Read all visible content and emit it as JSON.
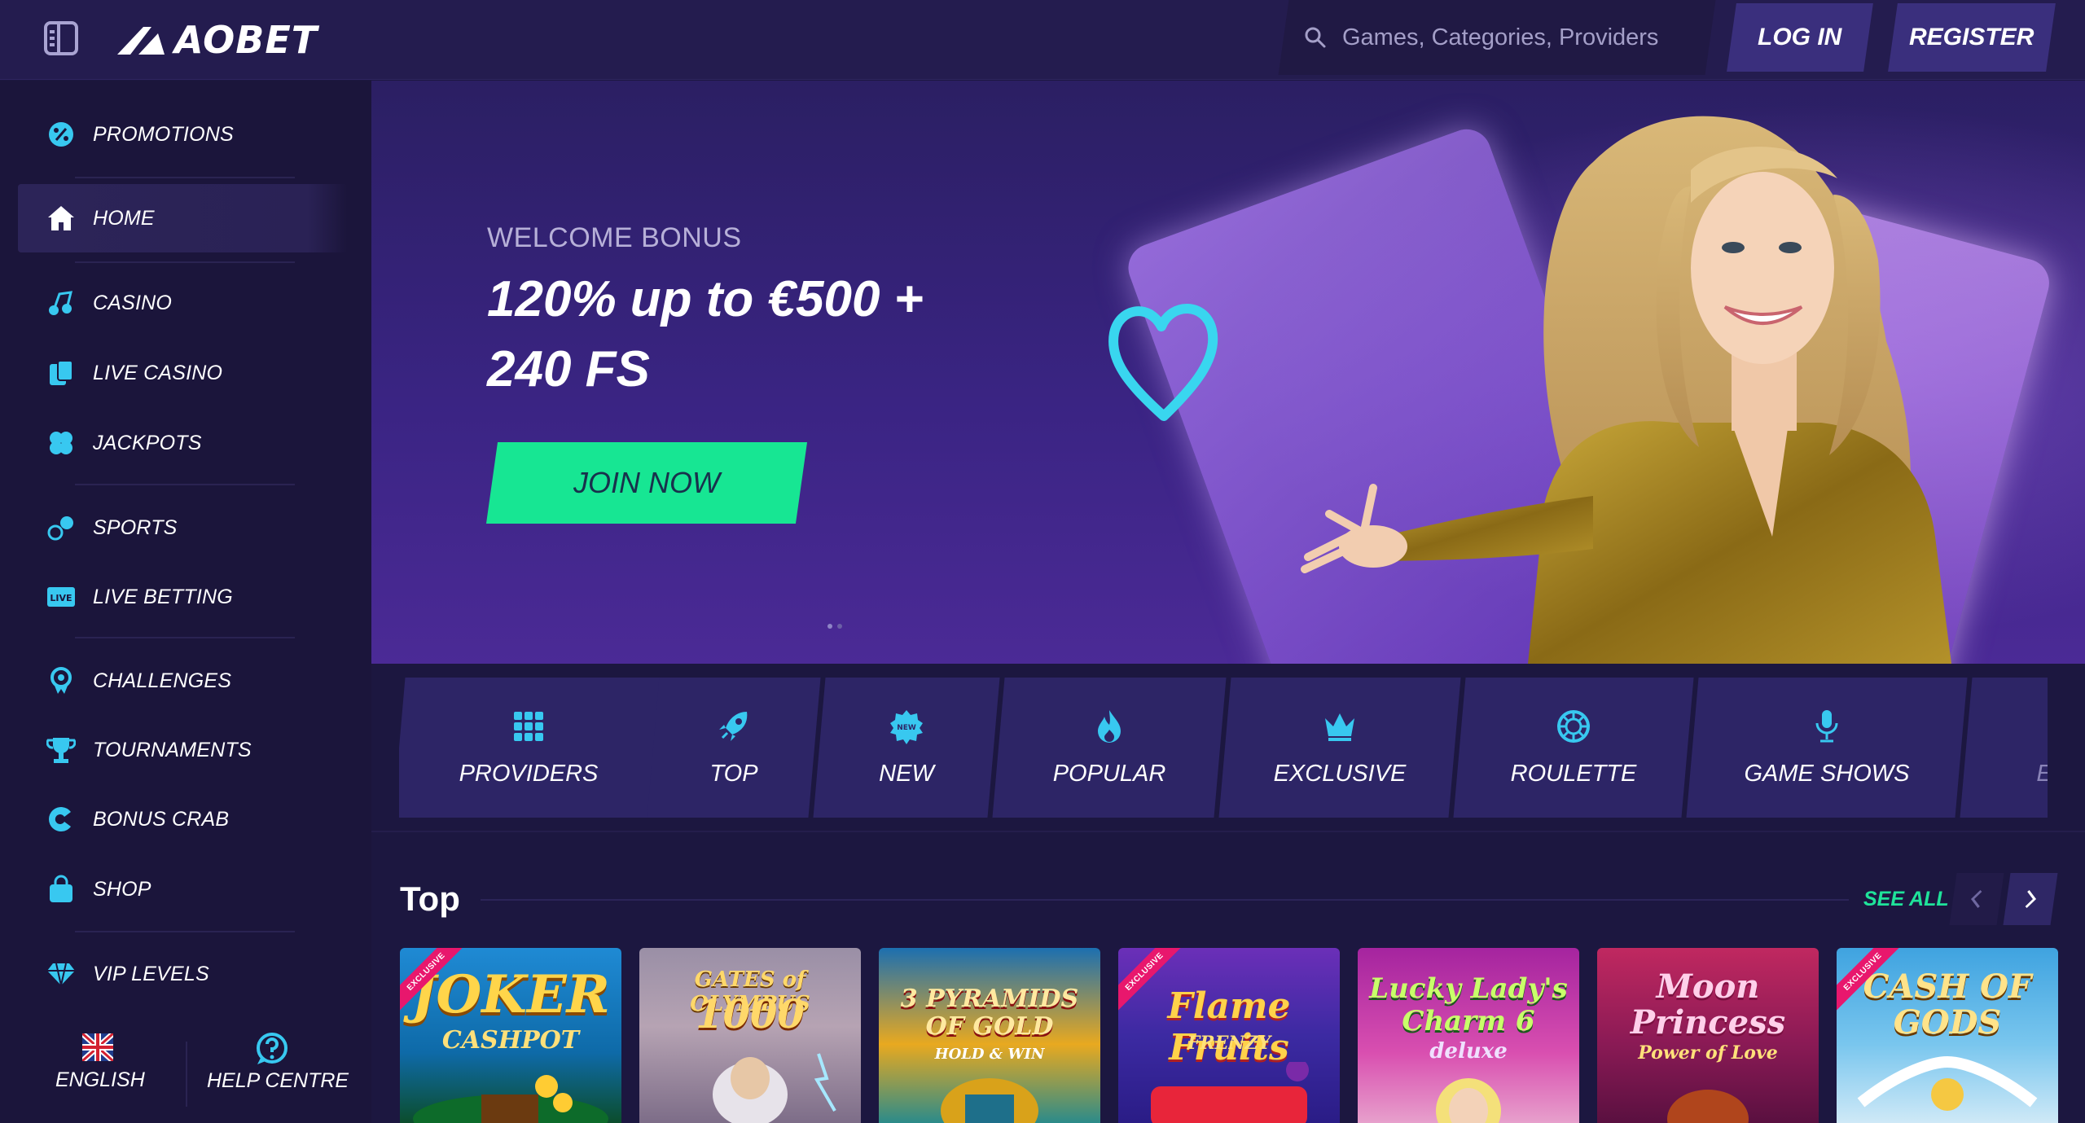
{
  "brand": {
    "name": "AOBET"
  },
  "header": {
    "search_placeholder": "Games, Categories, Providers",
    "login_label": "LOG IN",
    "register_label": "REGISTER"
  },
  "sidebar": {
    "items": [
      {
        "label": "PROMOTIONS",
        "icon": "promotions-icon"
      },
      {
        "label": "HOME",
        "icon": "home-icon",
        "active": true
      },
      {
        "label": "CASINO",
        "icon": "casino-icon"
      },
      {
        "label": "LIVE CASINO",
        "icon": "live-casino-icon"
      },
      {
        "label": "JACKPOTS",
        "icon": "jackpots-icon"
      },
      {
        "label": "SPORTS",
        "icon": "sports-icon"
      },
      {
        "label": "LIVE BETTING",
        "icon": "live-betting-icon"
      },
      {
        "label": "CHALLENGES",
        "icon": "challenges-icon"
      },
      {
        "label": "TOURNAMENTS",
        "icon": "tournaments-icon"
      },
      {
        "label": "BONUS CRAB",
        "icon": "bonus-crab-icon"
      },
      {
        "label": "SHOP",
        "icon": "shop-icon"
      },
      {
        "label": "VIP LEVELS",
        "icon": "vip-levels-icon"
      }
    ],
    "language_label": "ENGLISH",
    "help_label": "HELP CENTRE"
  },
  "hero": {
    "eyebrow": "WELCOME BONUS",
    "title_line1": "120% up to €500 +",
    "title_line2": "240 FS",
    "cta_label": "JOIN NOW"
  },
  "categories": [
    {
      "label": "PROVIDERS",
      "icon": "grid-icon"
    },
    {
      "label": "TOP",
      "icon": "rocket-icon"
    },
    {
      "label": "NEW",
      "icon": "new-badge-icon"
    },
    {
      "label": "POPULAR",
      "icon": "flame-icon"
    },
    {
      "label": "EXCLUSIVE",
      "icon": "crown-icon"
    },
    {
      "label": "ROULETTE",
      "icon": "roulette-icon"
    },
    {
      "label": "GAME SHOWS",
      "icon": "microphone-icon"
    },
    {
      "label": "E",
      "icon": ""
    }
  ],
  "section": {
    "title": "Top",
    "see_all_label": "SEE ALL"
  },
  "games": [
    {
      "name": "JOKER",
      "sub": "CASHPOT",
      "badge": "EXCLUSIVE"
    },
    {
      "name": "1000",
      "sub": "GATES of OLYMPUS",
      "badge": ""
    },
    {
      "name": "3 PYRAMIDS OF GOLD",
      "sub": "HOLD & WIN",
      "badge": ""
    },
    {
      "name": "Flame Fruits",
      "sub": "FRENZY",
      "badge": "EXCLUSIVE"
    },
    {
      "name": "Lucky Lady's Charm 6",
      "sub": "deluxe",
      "badge": ""
    },
    {
      "name": "Moon Princess",
      "sub": "Power of Love",
      "badge": ""
    },
    {
      "name": "CASH OF GODS",
      "sub": "",
      "badge": "EXCLUSIVE"
    }
  ],
  "colors": {
    "accent_green": "#17e693",
    "sidebar_bg": "#1b153b",
    "topbar_bg": "#241c4f",
    "button_bg": "#3a2f7d",
    "badge_pink": "#e8176d"
  }
}
